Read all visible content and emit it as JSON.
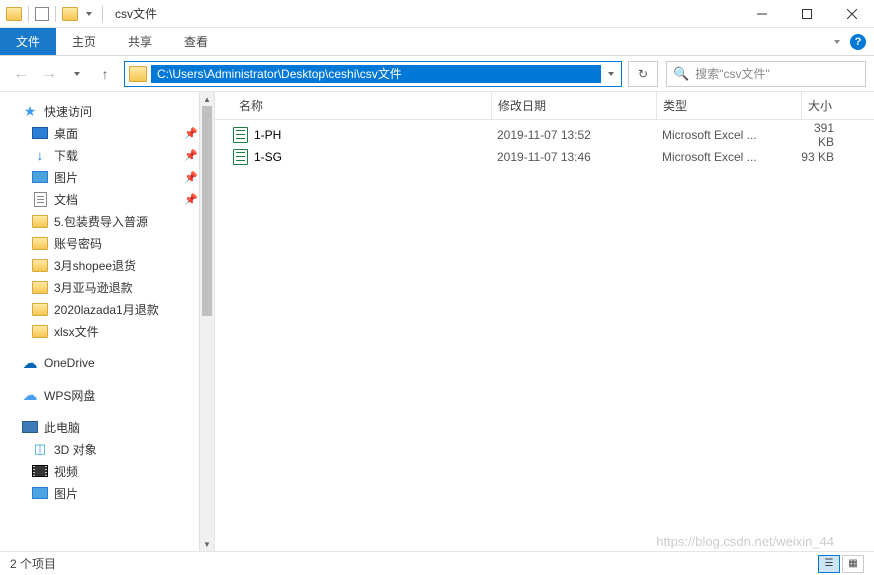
{
  "window": {
    "title": "csv文件"
  },
  "ribbon": {
    "file": "文件",
    "home": "主页",
    "share": "共享",
    "view": "查看"
  },
  "address": {
    "path": "C:\\Users\\Administrator\\Desktop\\ceshi\\csv文件"
  },
  "search": {
    "placeholder": "搜索\"csv文件\""
  },
  "columns": {
    "name": "名称",
    "date": "修改日期",
    "type": "类型",
    "size": "大小"
  },
  "sidebar": {
    "quickAccess": "快速访问",
    "desktop": "桌面",
    "downloads": "下载",
    "pictures": "图片",
    "documents": "文档",
    "f1": "5.包装费导入普源",
    "f2": "账号密码",
    "f3": "3月shopee退货",
    "f4": "3月亚马逊退款",
    "f5": "2020lazada1月退款",
    "f6": "xlsx文件",
    "onedrive": "OneDrive",
    "wps": "WPS网盘",
    "thispc": "此电脑",
    "objects3d": "3D 对象",
    "videos": "视频",
    "pictures2": "图片"
  },
  "files": [
    {
      "name": "1-PH",
      "date": "2019-11-07 13:52",
      "type": "Microsoft Excel ...",
      "size": "391 KB"
    },
    {
      "name": "1-SG",
      "date": "2019-11-07 13:46",
      "type": "Microsoft Excel ...",
      "size": "93 KB"
    }
  ],
  "status": {
    "items": "2 个项目"
  },
  "watermark": "https://blog.csdn.net/weixin_44"
}
